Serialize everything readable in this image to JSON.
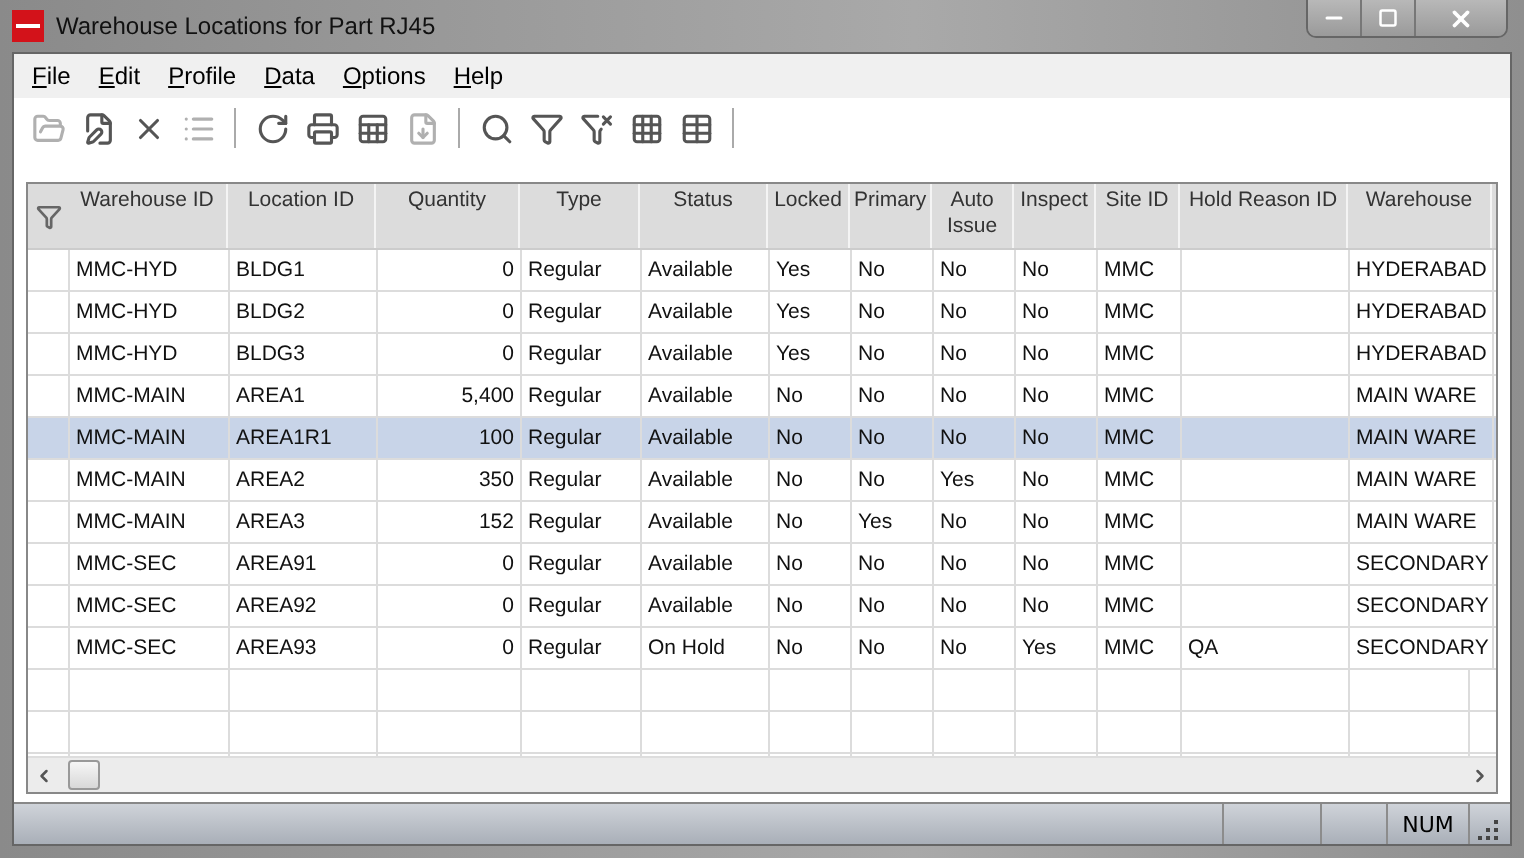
{
  "window": {
    "title": "Warehouse Locations for Part RJ45"
  },
  "menu": [
    "File",
    "Edit",
    "Profile",
    "Data",
    "Options",
    "Help"
  ],
  "toolbar": [
    {
      "kind": "open",
      "disabled": true
    },
    {
      "kind": "edit",
      "disabled": false
    },
    {
      "kind": "delete",
      "disabled": false
    },
    {
      "kind": "list",
      "disabled": true
    },
    {
      "kind": "sep"
    },
    {
      "kind": "refresh",
      "disabled": false
    },
    {
      "kind": "print",
      "disabled": false
    },
    {
      "kind": "export",
      "disabled": false
    },
    {
      "kind": "import",
      "disabled": true
    },
    {
      "kind": "sep"
    },
    {
      "kind": "search",
      "disabled": false
    },
    {
      "kind": "filter",
      "disabled": false
    },
    {
      "kind": "clearfilter",
      "disabled": false
    },
    {
      "kind": "grid",
      "disabled": false
    },
    {
      "kind": "gridcheck",
      "disabled": false
    },
    {
      "kind": "sep"
    }
  ],
  "table": {
    "columns": [
      "Warehouse ID",
      "Location ID",
      "Quantity",
      "Type",
      "Status",
      "Locked",
      "Primary",
      "Auto Issue",
      "Inspect",
      "Site ID",
      "Hold Reason ID",
      "Warehouse"
    ],
    "rows": [
      {
        "selected": false,
        "cells": [
          "MMC-HYD",
          "BLDG1",
          "0",
          "Regular",
          "Available",
          "Yes",
          "No",
          "No",
          "No",
          "MMC",
          "",
          "HYDERABAD"
        ]
      },
      {
        "selected": false,
        "cells": [
          "MMC-HYD",
          "BLDG2",
          "0",
          "Regular",
          "Available",
          "Yes",
          "No",
          "No",
          "No",
          "MMC",
          "",
          "HYDERABAD"
        ]
      },
      {
        "selected": false,
        "cells": [
          "MMC-HYD",
          "BLDG3",
          "0",
          "Regular",
          "Available",
          "Yes",
          "No",
          "No",
          "No",
          "MMC",
          "",
          "HYDERABAD"
        ]
      },
      {
        "selected": false,
        "cells": [
          "MMC-MAIN",
          "AREA1",
          "5,400",
          "Regular",
          "Available",
          "No",
          "No",
          "No",
          "No",
          "MMC",
          "",
          "MAIN WARE"
        ]
      },
      {
        "selected": true,
        "cells": [
          "MMC-MAIN",
          "AREA1R1",
          "100",
          "Regular",
          "Available",
          "No",
          "No",
          "No",
          "No",
          "MMC",
          "",
          "MAIN WARE"
        ]
      },
      {
        "selected": false,
        "cells": [
          "MMC-MAIN",
          "AREA2",
          "350",
          "Regular",
          "Available",
          "No",
          "No",
          "Yes",
          "No",
          "MMC",
          "",
          "MAIN WARE"
        ]
      },
      {
        "selected": false,
        "cells": [
          "MMC-MAIN",
          "AREA3",
          "152",
          "Regular",
          "Available",
          "No",
          "Yes",
          "No",
          "No",
          "MMC",
          "",
          "MAIN WARE"
        ]
      },
      {
        "selected": false,
        "cells": [
          "MMC-SEC",
          "AREA91",
          "0",
          "Regular",
          "Available",
          "No",
          "No",
          "No",
          "No",
          "MMC",
          "",
          "SECONDARY"
        ]
      },
      {
        "selected": false,
        "cells": [
          "MMC-SEC",
          "AREA92",
          "0",
          "Regular",
          "Available",
          "No",
          "No",
          "No",
          "No",
          "MMC",
          "",
          "SECONDARY"
        ]
      },
      {
        "selected": false,
        "cells": [
          "MMC-SEC",
          "AREA93",
          "0",
          "Regular",
          "On Hold",
          "No",
          "No",
          "No",
          "Yes",
          "MMC",
          "QA",
          "SECONDARY"
        ]
      }
    ]
  },
  "status_bar": {
    "indicator": "NUM"
  }
}
